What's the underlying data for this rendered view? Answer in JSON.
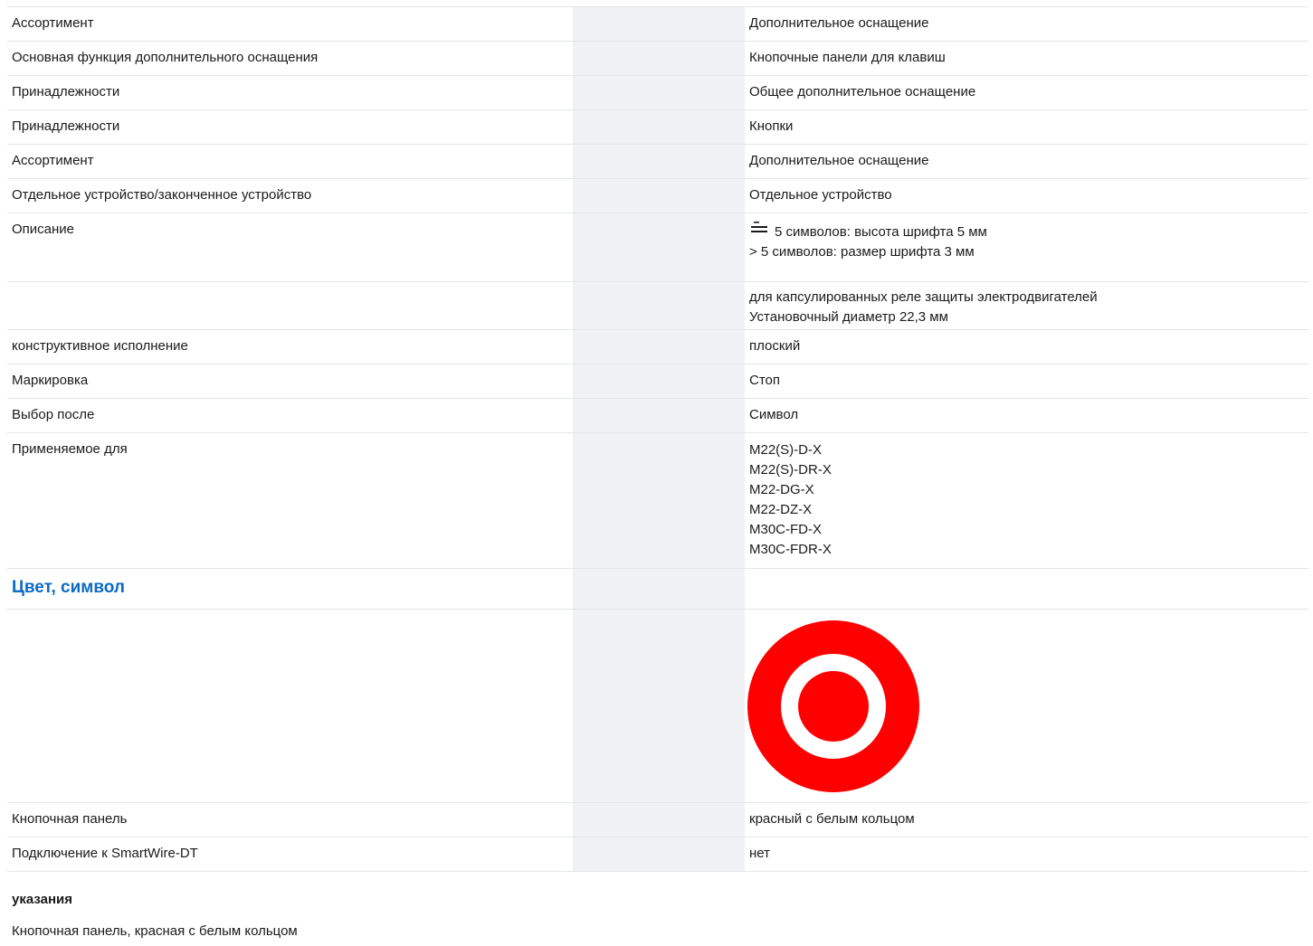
{
  "rows": {
    "r1": {
      "name": "Ассортимент",
      "value": "Дополнительное оснащение"
    },
    "r2": {
      "name": "Основная функция дополнительного оснащения",
      "value": "Кнопочные панели для клавиш"
    },
    "r3": {
      "name": "Принадлежности",
      "value": "Общее дополнительное оснащение"
    },
    "r4": {
      "name": "Принадлежности",
      "value": "Кнопки"
    },
    "r5": {
      "name": "Ассортимент",
      "value": "Дополнительное оснащение"
    },
    "r6": {
      "name": "Отдельное устройство/законченное устройство",
      "value": "Отдельное устройство"
    },
    "r7": {
      "name": "Описание",
      "value_line1": "5 символов: высота шрифта 5 мм",
      "value_line2": "> 5 символов: размер шрифта 3 мм"
    },
    "r8": {
      "name": "",
      "value_line1": "для капсулированных реле защиты электродвигателей",
      "value_line2": "Установочный диаметр 22,3 мм"
    },
    "r9": {
      "name": "конструктивное исполнение",
      "value": "плоский"
    },
    "r10": {
      "name": "Маркировка",
      "value": "Стоп"
    },
    "r11": {
      "name": "Выбор после",
      "value": "Символ"
    },
    "r12": {
      "name": "Применяемое для",
      "values": [
        "M22(S)-D-X",
        "M22(S)-DR-X",
        "M22-DG-X",
        "M22-DZ-X",
        "M30C-FD-X",
        "M30C-FDR-X"
      ]
    }
  },
  "section": {
    "title": "Цвет, символ"
  },
  "symbol": {
    "outer_color": "#ff0000",
    "ring_color": "#ffffff",
    "center_color": "#ff0000"
  },
  "rows2": {
    "r13": {
      "name": "Кнопочная панель",
      "value": "красный с белым кольцом"
    },
    "r14": {
      "name": "Подключение к SmartWire-DT",
      "value": "нет"
    }
  },
  "notes": {
    "title": "указания",
    "text": "Кнопочная панель, красная с белым кольцом"
  },
  "colors": {
    "accent": "#0a6ac4",
    "zebra": "#eff1f4",
    "border": "#e3e6ea"
  }
}
